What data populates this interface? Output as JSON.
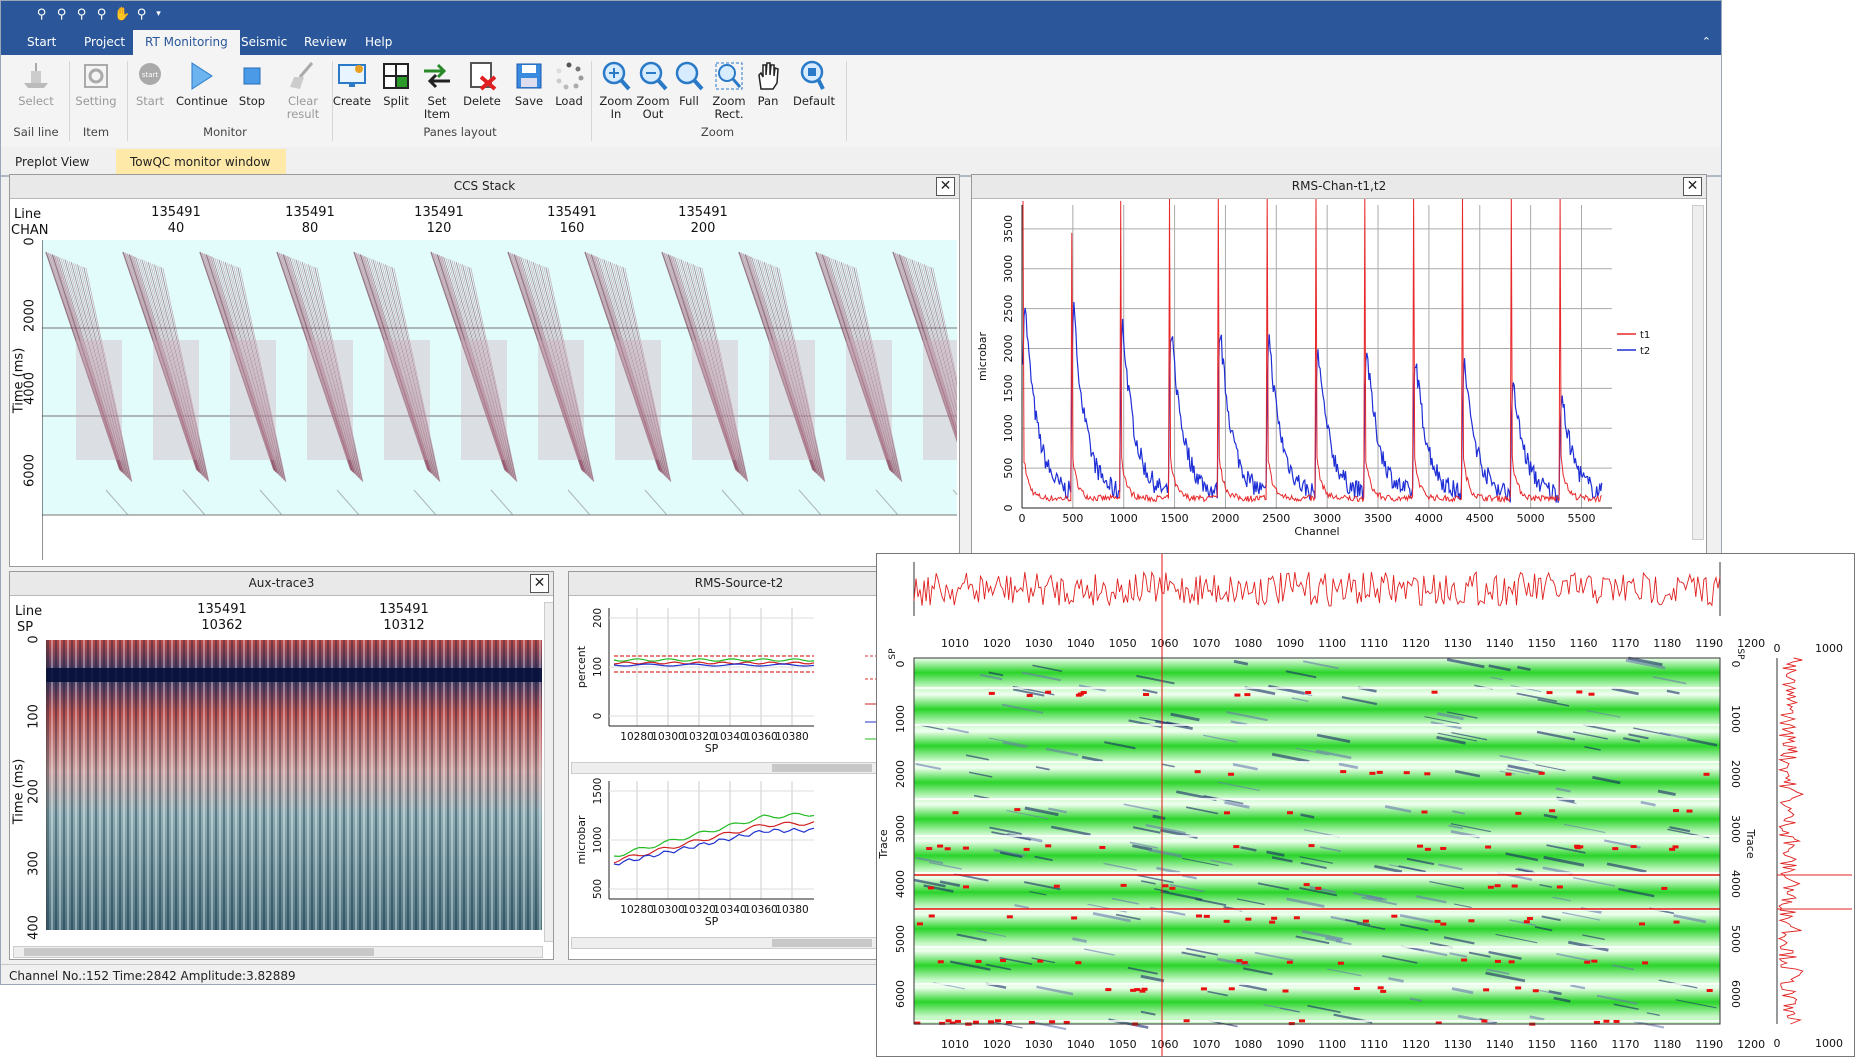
{
  "ribbon_tabs": [
    {
      "label": "Start"
    },
    {
      "label": "Project"
    },
    {
      "label": "RT Monitoring",
      "active": true
    },
    {
      "label": "Seismic"
    },
    {
      "label": "Review"
    },
    {
      "label": "Help"
    }
  ],
  "ribbon": {
    "groups": [
      "Sail line",
      "Item",
      "Monitor",
      "Panes layout",
      "Zoom"
    ],
    "select": "Select",
    "setting": "Setting",
    "start": "Start",
    "continue": "Continue",
    "stop": "Stop",
    "clear1": "Clear",
    "clear2": "result",
    "create": "Create",
    "split": "Split",
    "setitem1": "Set",
    "setitem2": "Item",
    "delete": "Delete",
    "save": "Save",
    "load": "Load",
    "zoomin1": "Zoom",
    "zoomin2": "In",
    "zoomout1": "Zoom",
    "zoomout2": "Out",
    "full": "Full",
    "zoomrect1": "Zoom",
    "zoomrect2": "Rect.",
    "pan": "Pan",
    "default": "Default"
  },
  "doc_tabs": {
    "preplot": "Preplot View",
    "towqc": "TowQC monitor window",
    "close": "×"
  },
  "icons": {
    "close": "close-icon",
    "zoom": "zoom-icon",
    "pan": "hand-icon"
  },
  "colors": {
    "ribbon_blue": "#2b579a",
    "active_tab": "#ffe9a8",
    "t1": "#e8282a",
    "t2": "#1f2fd6",
    "green": "#22cc22"
  },
  "ccs_stack": {
    "title": "CCS Stack",
    "row1": "Line",
    "row2": "CHAN",
    "line_value": "135491",
    "chan_ticks": [
      "40",
      "80",
      "120",
      "160",
      "200"
    ],
    "y_ticks": [
      "0",
      "2000",
      "4000",
      "6000"
    ],
    "ylabel": "Time (ms)"
  },
  "rms_chan": {
    "title": "RMS-Chan-t1,t2",
    "ylabel": "microbar",
    "xlabel": "Channel",
    "x_ticks": [
      "0",
      "500",
      "1000",
      "1500",
      "2000",
      "2500",
      "3000",
      "3500",
      "4000",
      "4500",
      "5000",
      "5500"
    ],
    "y_ticks": [
      "0",
      "500",
      "1000",
      "1500",
      "2000",
      "2500",
      "3000",
      "3500"
    ],
    "legend": [
      "t1",
      "t2"
    ]
  },
  "aux_trace": {
    "title": "Aux-trace3",
    "row1": "Line",
    "row2": "SP",
    "line_value": "135491",
    "sp_ticks": [
      "10362",
      "10312"
    ],
    "y_ticks": [
      "0",
      "100",
      "200",
      "300",
      "400"
    ],
    "ylabel": "Time (ms)"
  },
  "rms_source": {
    "title": "RMS-Source-t2",
    "top": {
      "ylabel": "percent",
      "y_ticks": [
        "200",
        "100",
        "0"
      ]
    },
    "bottom": {
      "ylabel": "microbar",
      "y_ticks": [
        "1500",
        "1000",
        "500"
      ]
    },
    "x_ticks": [
      "10280",
      "10300",
      "10320",
      "10340",
      "10360",
      "10380"
    ],
    "xlabel": "SP"
  },
  "overlay": {
    "x_ticks": [
      "1010",
      "1020",
      "1030",
      "1040",
      "1050",
      "1060",
      "1070",
      "1080",
      "1090",
      "1100",
      "1110",
      "1120",
      "1130",
      "1140",
      "1150",
      "1160",
      "1170",
      "1180",
      "1190",
      "1200"
    ],
    "y_ticks": [
      "0",
      "1000",
      "2000",
      "3000",
      "4000",
      "5000",
      "6000"
    ],
    "side_ticks": [
      "0",
      "1000"
    ],
    "sp_label": "SP",
    "trace_label": "Trace"
  },
  "status": "Channel No.:152 Time:2842 Amplitude:3.82889"
}
